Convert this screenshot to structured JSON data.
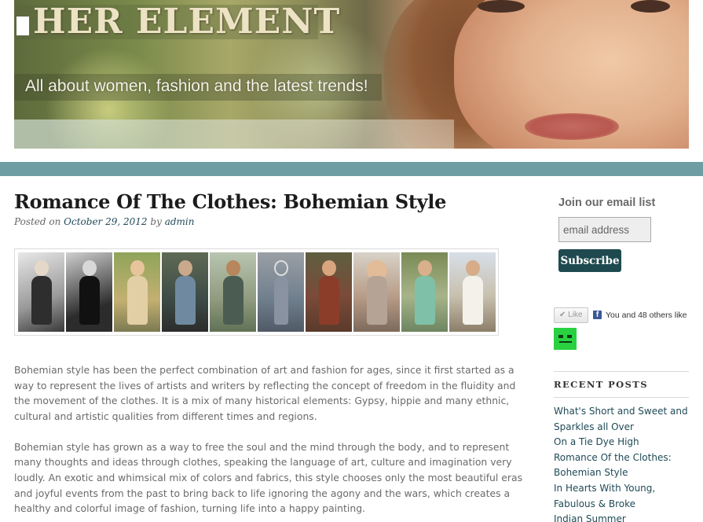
{
  "header": {
    "site_title": "HER ELEMENT",
    "tagline": "All about women, fashion and the latest trends!"
  },
  "post": {
    "title": "Romance Of The Clothes: Bohemian Style",
    "meta_prefix": "Posted on",
    "date": "October 29, 2012",
    "meta_by": "by",
    "author": "admin",
    "paragraphs": [
      "Bohemian style has been the perfect combination of art and fashion for ages, since it first started as a way to represent the lives of artists and writers by reflecting the concept of freedom in the fluidity and the movement of the clothes. It is a mix of many historical elements: Gypsy, hippie and many ethnic, cultural and artistic qualities from different times and regions.",
      "Bohemian style has grown as a way to free the soul and the mind through the body, and to represent many thoughts and ideas through clothes, speaking the language of art, culture and imagination very loudly. An exotic and whimsical mix of colors and fabrics, this style chooses only the most beautiful eras and joyful events from the past to bring back to life ignoring the agony and the wars, which creates a healthy and colorful image of fashion, turning life into a happy painting."
    ]
  },
  "sidebar": {
    "email": {
      "heading": "Join our email list",
      "placeholder": "email address",
      "button": "Subscribe"
    },
    "facebook": {
      "like_label": "✔ Like",
      "icon": "f",
      "like_text": "You and 48 others like t"
    },
    "recent": {
      "heading": "RECENT POSTS",
      "items": [
        "What's Short and Sweet and Sparkles all Over",
        "On a Tie Dye High",
        "Romance Of the Clothes: Bohemian Style",
        "In Hearts With Young, Fabulous & Broke",
        "Indian Summer"
      ]
    }
  },
  "colors": {
    "navbar": "#6e9ea3",
    "link": "#1f4a57",
    "subscribe_button": "#1e4a4f",
    "avatar": "#29d141"
  }
}
